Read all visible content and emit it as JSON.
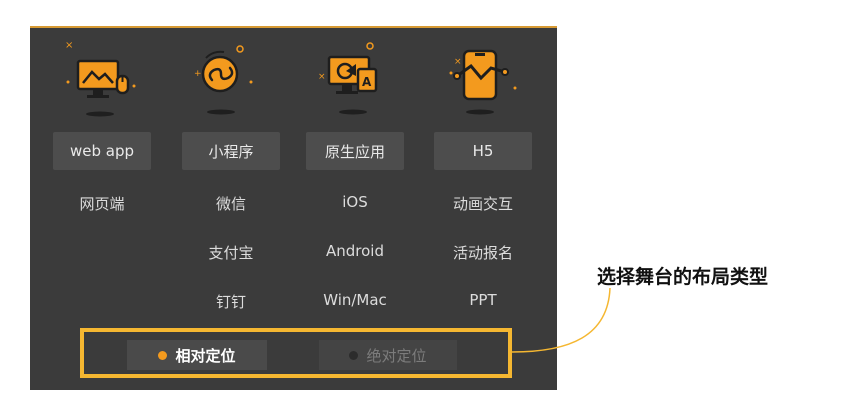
{
  "platforms": [
    {
      "icon": "web-app-monitor-icon",
      "label": "web app",
      "items": [
        "网页端",
        "",
        ""
      ]
    },
    {
      "icon": "mini-program-link-icon",
      "label": "小程序",
      "items": [
        "微信",
        "支付宝",
        "钉钉"
      ]
    },
    {
      "icon": "native-app-desktop-icon",
      "label": "原生应用",
      "items": [
        "iOS",
        "Android",
        "Win/Mac"
      ]
    },
    {
      "icon": "h5-phone-chart-icon",
      "label": "H5",
      "items": [
        "动画交互",
        "活动报名",
        "PPT"
      ]
    }
  ],
  "layout_toggle": {
    "options": [
      {
        "label": "相对定位",
        "selected": true
      },
      {
        "label": "绝对定位",
        "selected": false
      }
    ]
  },
  "annotation": {
    "text": "选择舞台的布局类型"
  },
  "colors": {
    "accent": "#f5b731",
    "icon_orange": "#f39a1e",
    "panel": "#3b3b3b"
  }
}
